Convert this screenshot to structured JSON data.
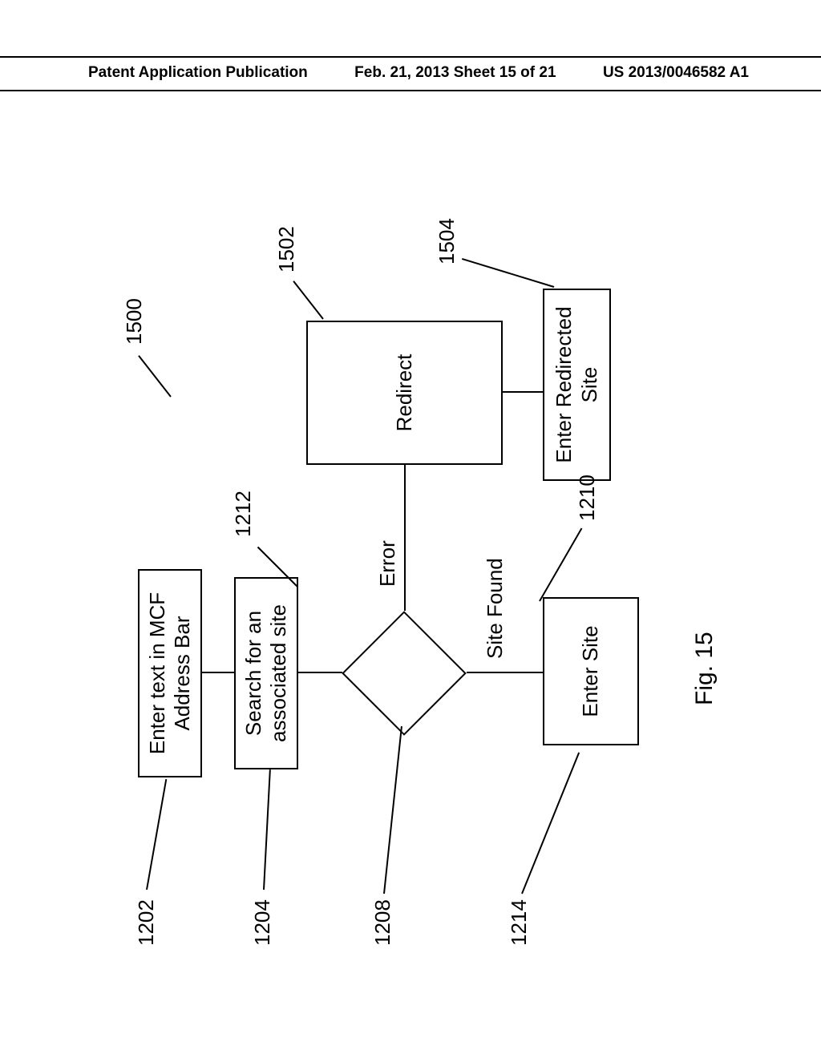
{
  "header": {
    "left": "Patent Application Publication",
    "center": "Feb. 21, 2013  Sheet 15 of 21",
    "right": "US 2013/0046582 A1"
  },
  "diagram": {
    "figure_caption": "Fig. 15",
    "nodes": {
      "enter_text": {
        "label": "Enter text in MCF\nAddress Bar",
        "ref": "1202"
      },
      "search": {
        "label": "Search for an\nassociated site",
        "ref": "1204"
      },
      "decision": {
        "ref": "1208"
      },
      "enter_site": {
        "label": "Enter Site",
        "ref": "1214"
      },
      "redirect": {
        "label": "Redirect",
        "ref_parent": "1500",
        "ref_self": "1502"
      },
      "enter_redirected": {
        "label": "Enter Redirected\nSite",
        "ref": "1504"
      }
    },
    "edges": {
      "error": "Error",
      "site_found": "Site Found",
      "ref_1212": "1212",
      "ref_1210": "1210"
    }
  }
}
